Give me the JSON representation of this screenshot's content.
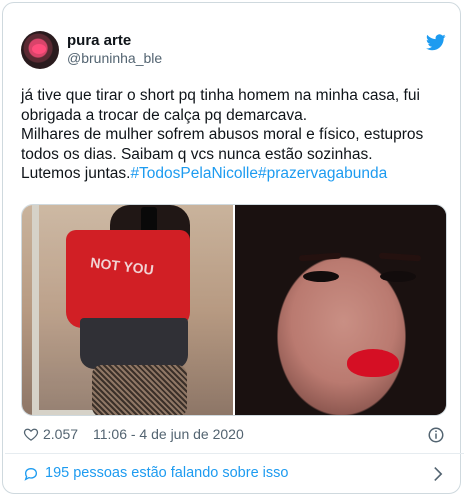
{
  "user": {
    "display_name": "pura arte",
    "handle": "@bruninha_ble",
    "avatar": "avatar-photo",
    "platform_icon": "twitter-bird-icon"
  },
  "tweet": {
    "lines": [
      "já tive que tirar o short pq tinha homem na minha casa, fui",
      "obrigada a trocar de calça pq demarcava.",
      "Milhares de mulher sofrem abusos moral e físico, estupros",
      "todos os dias. Saibam q vcs nunca estão sozinhas.",
      "Lutemos juntas."
    ],
    "hashtags": [
      "#TodosPelaNicolle",
      "#prazervagabunda"
    ]
  },
  "media": {
    "left_shirt_text": "NOT YOU",
    "images": [
      "mirror-selfie-photo",
      "close-up-face-photo"
    ]
  },
  "meta": {
    "likes": "2.057",
    "timestamp": "11:06 - 4 de jun de 2020",
    "icons": [
      "heart-icon",
      "info-icon"
    ]
  },
  "conversation": {
    "text": "195 pessoas estão falando sobre isso",
    "icons": [
      "chat-bubble-icon",
      "chevron-right-icon"
    ]
  },
  "colors": {
    "accent": "#1d9bf0",
    "border": "#cfd9de",
    "text": "#0f1419",
    "muted": "#536471"
  }
}
